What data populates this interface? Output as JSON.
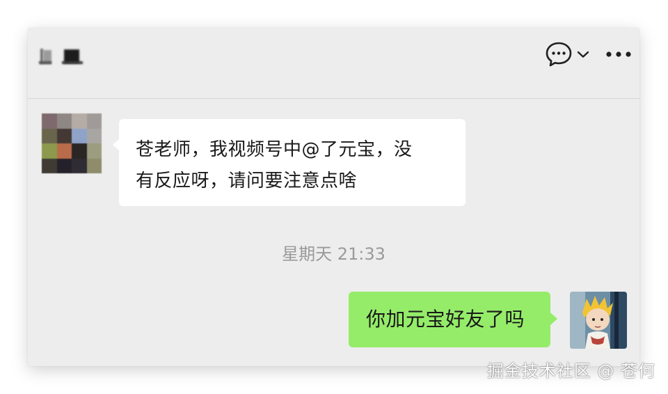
{
  "header": {
    "chat_icon": "chat-bubble-icon",
    "dropdown_icon": "chevron-down-icon",
    "more_icon": "more-dots-icon"
  },
  "messages": [
    {
      "direction": "incoming",
      "text": "苍老师，我视频号中@了元宝，没\n有反应呀，请问要注意点啥"
    },
    {
      "direction": "outgoing",
      "text": "你加元宝好友了吗"
    }
  ],
  "timestamp": "星期天 21:33",
  "watermark": "掘金技术社区 @ 苍何",
  "colors": {
    "chat_background": "#ededed",
    "outgoing_bubble": "#95ec69",
    "incoming_bubble": "#ffffff",
    "timestamp": "#9a9a9a"
  }
}
